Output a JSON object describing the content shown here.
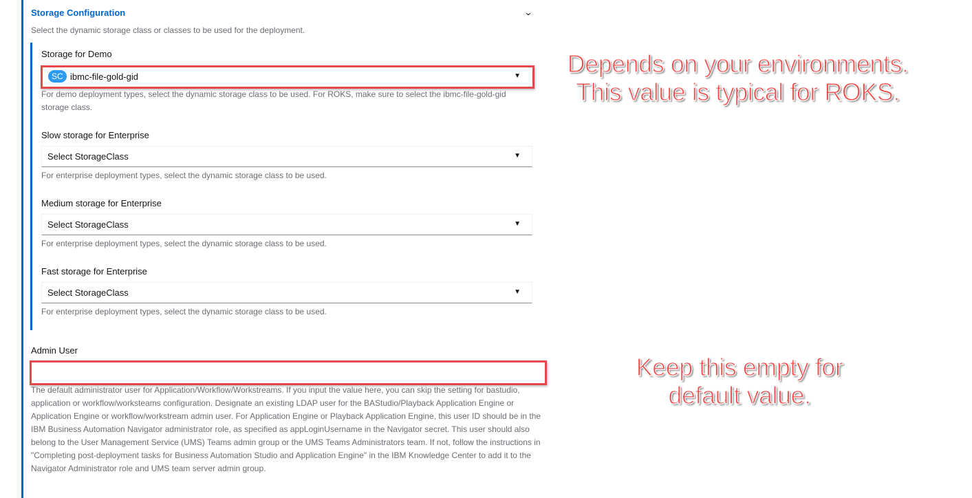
{
  "section": {
    "title": "Storage Configuration",
    "description": "Select the dynamic storage class or classes to be used for the deployment."
  },
  "storage_demo": {
    "label": "Storage for Demo",
    "badge": "SC",
    "value": "ibmc-file-gold-gid",
    "helper": "For demo deployment types, select the dynamic storage class to be used. For ROKS, make sure to select the ibmc-file-gold-gid storage class."
  },
  "storage_slow": {
    "label": "Slow storage for Enterprise",
    "value": "Select StorageClass",
    "helper": "For enterprise deployment types, select the dynamic storage class to be used."
  },
  "storage_medium": {
    "label": "Medium storage for Enterprise",
    "value": "Select StorageClass",
    "helper": "For enterprise deployment types, select the dynamic storage class to be used."
  },
  "storage_fast": {
    "label": "Fast storage for Enterprise",
    "value": "Select StorageClass",
    "helper": "For enterprise deployment types, select the dynamic storage class to be used."
  },
  "admin_user": {
    "label": "Admin User",
    "value": "",
    "helper": "The default administrator user for Application/Workflow/Workstreams. If you input the value here, you can skip the setting for bastudio, application or workflow/worksteams configuration. Designate an existing LDAP user for the BAStudio/Playback Application Engine or Application Engine or workflow/workstream admin user. For Application Engine or Playback Application Engine, this user ID should be in the IBM Business Automation Navigator administrator role, as specified as appLoginUsername in the Navigator secret. This user should also belong to the User Management Service (UMS) Teams admin group or the UMS Teams Administrators team. If not, follow the instructions in \"Completing post-deployment tasks for Business Automation Studio and Application Engine\" in the IBM Knowledge Center to add it to the Navigator Administrator role and UMS team server admin group."
  },
  "annotations": {
    "storage_note": "Depends on your environments. This value is typical for ROKS.",
    "admin_note": "Keep this empty for default value."
  },
  "icons": {
    "collapse": "chevron-down-icon",
    "dropdown": "caret-down-icon"
  },
  "colors": {
    "accent": "#0066cc",
    "badge": "#2b9af3",
    "annotation": "#ee4b4b",
    "helper_text": "#6a6e73"
  }
}
